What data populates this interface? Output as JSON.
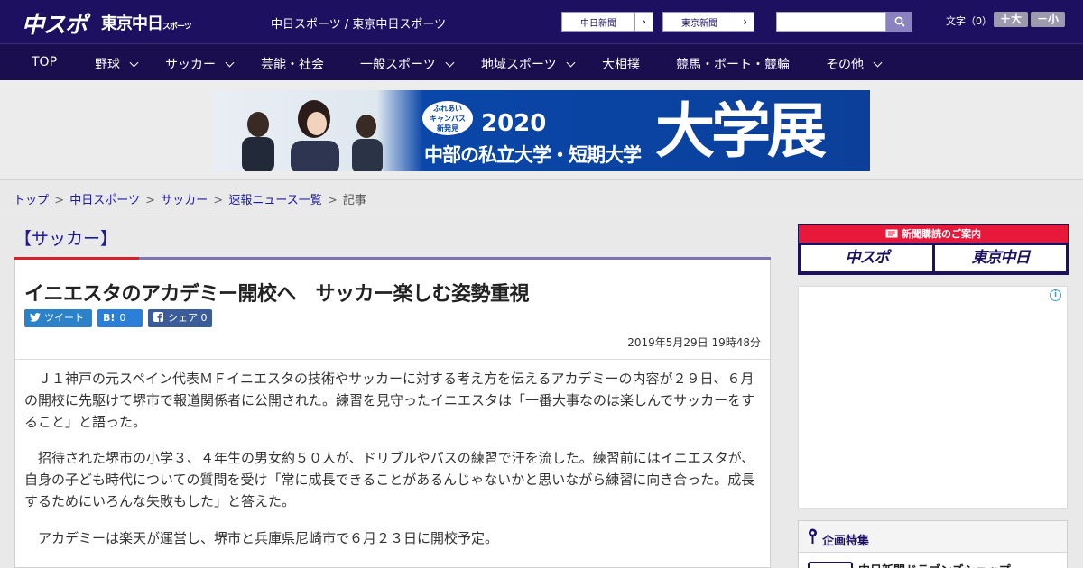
{
  "header": {
    "logo_main": "中スポ",
    "logo_sub": "東京中日",
    "logo_sub_small": "スポーツ",
    "site_links": "中日スポーツ / 東京中日スポーツ",
    "paper_links": [
      {
        "label": "中日新聞",
        "arrow": "›"
      },
      {
        "label": "東京新聞",
        "arrow": "›"
      }
    ],
    "search": {
      "placeholder": "",
      "value": ""
    },
    "font_size_label": "文字（0）",
    "font_larger": "＋大",
    "font_smaller": "－小"
  },
  "nav": {
    "items": [
      {
        "label": "TOP",
        "has_menu": false
      },
      {
        "label": "野球",
        "has_menu": true
      },
      {
        "label": "サッカー",
        "has_menu": true
      },
      {
        "label": "芸能・社会",
        "has_menu": false
      },
      {
        "label": "一般スポーツ",
        "has_menu": true
      },
      {
        "label": "地域スポーツ",
        "has_menu": true
      },
      {
        "label": "大相撲",
        "has_menu": false
      },
      {
        "label": "競馬・ボート・競輪",
        "has_menu": false
      },
      {
        "label": "その他",
        "has_menu": true
      }
    ]
  },
  "banner": {
    "badge_line1": "ふれあい",
    "badge_line2": "キャンパス",
    "badge_line3": "新発見",
    "year": "2020",
    "subtitle": "中部の私立大学・短期大学",
    "big_text": "大学展"
  },
  "breadcrumb": {
    "items": [
      "トップ",
      "中日スポーツ",
      "サッカー",
      "速報ニュース一覧"
    ],
    "current": "記事",
    "separator": ">"
  },
  "article": {
    "category": "【サッカー】",
    "headline": "イニエスタのアカデミー開校へ　サッカー楽しむ姿勢重視",
    "share": {
      "tweet_label": "ツイート",
      "hatena_icon": "B!",
      "hatena_count": "0",
      "facebook_label": "シェア",
      "facebook_count": "0"
    },
    "date": "2019年5月29日 19時48分",
    "paragraphs": [
      "　Ｊ１神戸の元スペイン代表ＭＦイニエスタの技術やサッカーに対する考え方を伝えるアカデミーの内容が２９日、６月の開校に先駆けて堺市で報道関係者に公開された。練習を見守ったイニエスタは「一番大事なのは楽しんでサッカーをすること」と語った。",
      "　招待された堺市の小学３、４年生の男女約５０人が、ドリブルやパスの練習で汗を流した。練習前にはイニエスタが、自身の子ども時代についての質問を受け「常に成長できることがあるんじゃないかと思いながら練習に向き合った。成長するためにいろんな失敗もした」と答えた。",
      "　アカデミーは楽天が運営し、堺市と兵庫県尼崎市で６月２３日に開校予定。"
    ]
  },
  "sidebar": {
    "subscription": {
      "title": "新聞購読のご案内",
      "button1": "中スポ",
      "button2": "東京中日"
    },
    "ad_info_icon": "i",
    "feature": {
      "title": "企画特集",
      "item": "中日新聞ドラゴンズショップ"
    }
  },
  "colors": {
    "header_bg": "#1e1060",
    "nav_bg": "#1b0e4f",
    "link": "#1e1aa0",
    "accent_red": "#d8202a",
    "accent_purple": "#7e73b5",
    "twitter": "#2c82c9",
    "facebook": "#3b5b99"
  }
}
